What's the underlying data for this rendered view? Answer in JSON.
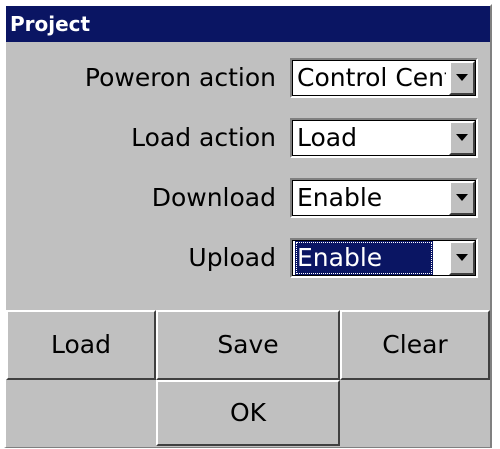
{
  "dialog": {
    "title": "Project"
  },
  "fields": [
    {
      "label": "Poweron action",
      "value": "Control Center"
    },
    {
      "label": "Load action",
      "value": "Load"
    },
    {
      "label": "Download",
      "value": "Enable"
    },
    {
      "label": "Upload",
      "value": "Enable"
    }
  ],
  "buttons": {
    "load": "Load",
    "save": "Save",
    "clear": "Clear",
    "ok": "OK"
  },
  "icons": {
    "dropdown": "chevron-down-icon"
  },
  "colors": {
    "titlebar": "#0a1563",
    "face": "#c0c0c0",
    "selection": "#0a1563"
  }
}
